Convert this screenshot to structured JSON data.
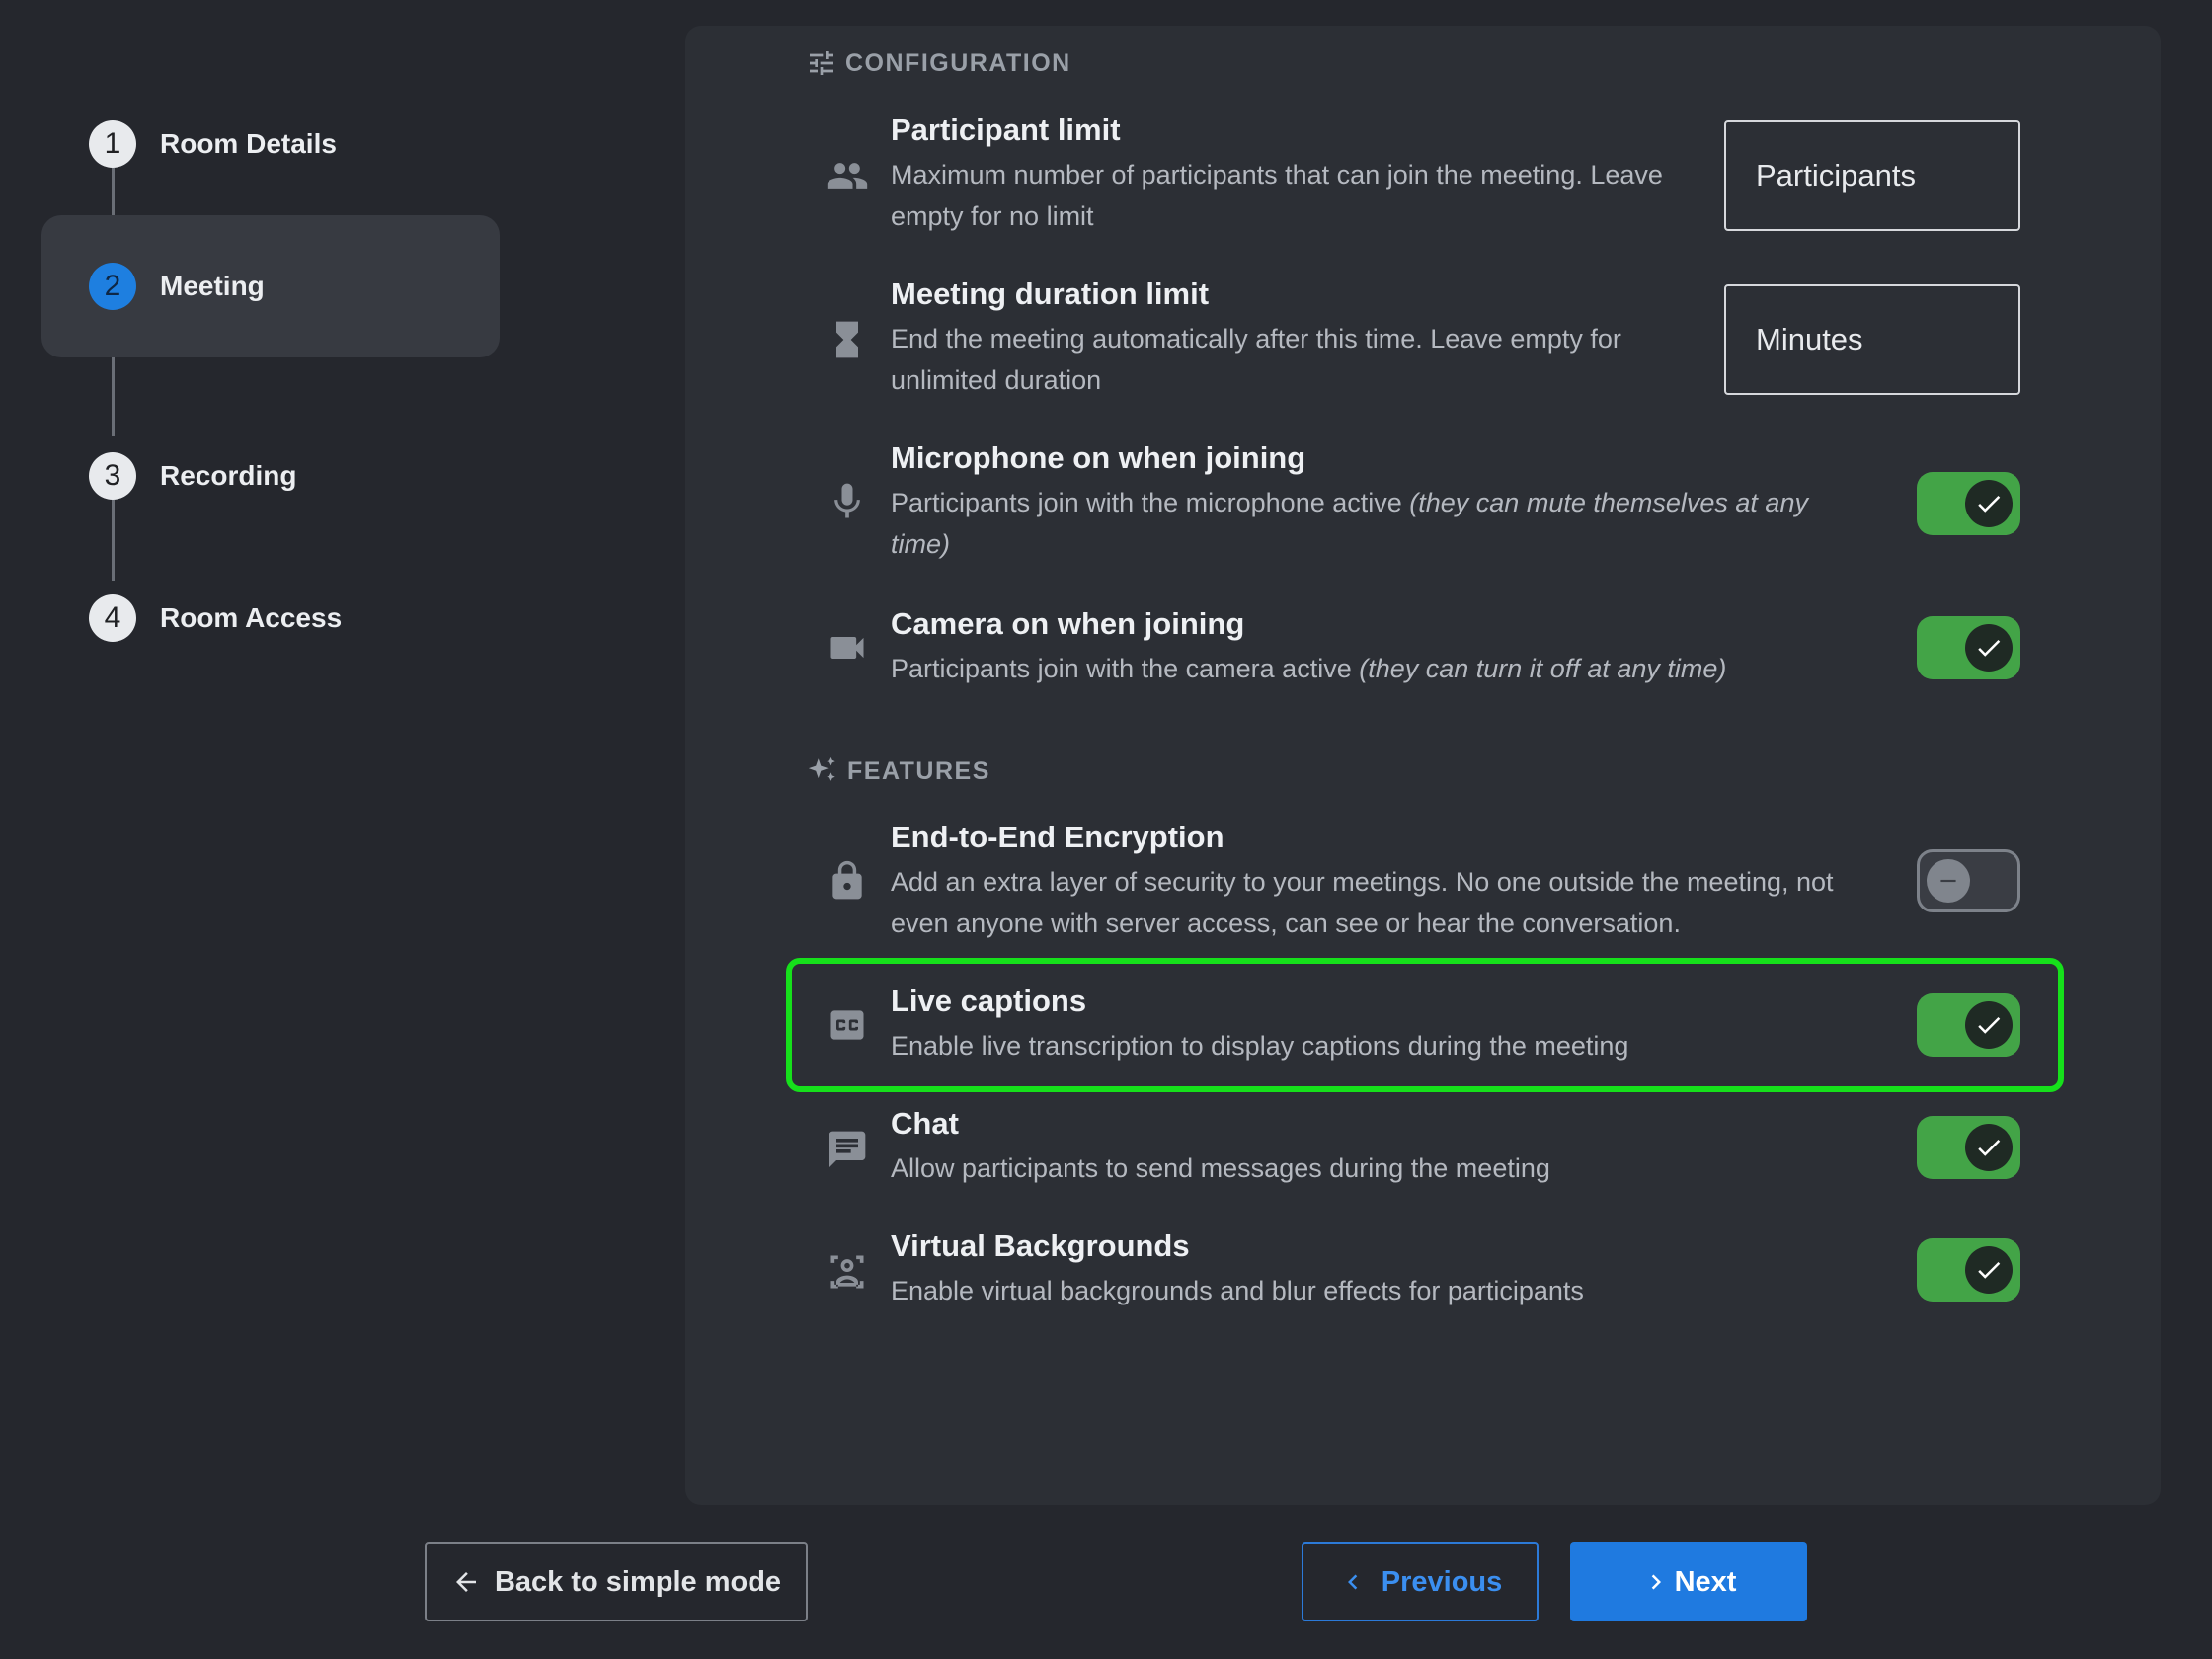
{
  "stepper": {
    "steps": [
      {
        "number": "1",
        "label": "Room Details",
        "active": false
      },
      {
        "number": "2",
        "label": "Meeting",
        "active": true
      },
      {
        "number": "3",
        "label": "Recording",
        "active": false
      },
      {
        "number": "4",
        "label": "Room Access",
        "active": false
      }
    ]
  },
  "configuration": {
    "heading": "CONFIGURATION",
    "participant_limit": {
      "icon": "people-icon",
      "title": "Participant limit",
      "desc_line1": "Maximum number of participants that can join the meeting. Leave",
      "desc_line2": "empty for no limit",
      "placeholder": "Participants",
      "value": ""
    },
    "duration_limit": {
      "icon": "hourglass-icon",
      "title": "Meeting duration limit",
      "desc_line1": "End the meeting automatically after this time. Leave empty for",
      "desc_line2": "unlimited duration",
      "placeholder": "Minutes",
      "value": ""
    },
    "microphone": {
      "icon": "microphone-icon",
      "title": "Microphone on when joining",
      "desc": "Participants join with the microphone active ",
      "desc_em_line1": "(they can mute themselves at any",
      "desc_em_line2": "time)",
      "enabled": true
    },
    "camera": {
      "icon": "videocam-icon",
      "title": "Camera on when joining",
      "desc": "Participants join with the camera active ",
      "desc_em": "(they can turn it off at any time)",
      "enabled": true
    }
  },
  "features": {
    "heading": "FEATURES",
    "e2ee": {
      "icon": "lock-icon",
      "title": "End-to-End Encryption",
      "desc_line1": "Add an extra layer of security to your meetings. No one outside the meeting, not",
      "desc_line2": "even anyone with server access, can see or hear the conversation.",
      "enabled": false
    },
    "captions": {
      "icon": "closed-caption-icon",
      "title": "Live captions",
      "desc": "Enable live transcription to display captions during the meeting",
      "enabled": true
    },
    "chat": {
      "icon": "chat-icon",
      "title": "Chat",
      "desc": "Allow participants to send messages during the meeting",
      "enabled": true
    },
    "backgrounds": {
      "icon": "background-replace-icon",
      "title": "Virtual Backgrounds",
      "desc": "Enable virtual backgrounds and blur effects for participants",
      "enabled": true
    }
  },
  "footer": {
    "back_label": "Back to simple mode",
    "prev_label": "Previous",
    "next_label": "Next"
  },
  "colors": {
    "accent": "#1f7ae0",
    "toggle_on": "#43a447",
    "highlight": "#16e01b"
  }
}
